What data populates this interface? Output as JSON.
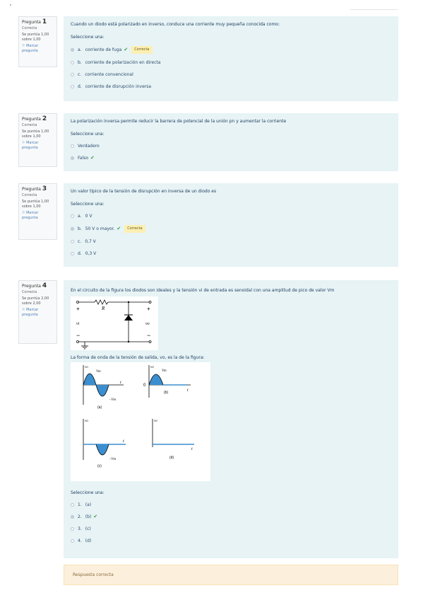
{
  "questions": [
    {
      "number_label": "Pregunta",
      "number": "1",
      "status": "Correcta",
      "points": "Se puntúa 1,00 sobre 1,00",
      "flag_label": "Marcar pregunta",
      "text": "Cuando un diodo está polarizado en inverso, conduce una corriente muy pequeña conocida como:",
      "prompt": "Seleccione una:",
      "options": [
        {
          "letter": "a.",
          "label": "corriente de fuga",
          "selected": true,
          "correct": true,
          "badge": "Correcta"
        },
        {
          "letter": "b.",
          "label": "corriente de polarización en directa",
          "selected": false
        },
        {
          "letter": "c.",
          "label": "corriente convencional",
          "selected": false
        },
        {
          "letter": "d.",
          "label": "corriente de disrupción inversa",
          "selected": false
        }
      ]
    },
    {
      "number_label": "Pregunta",
      "number": "2",
      "status": "Correcta",
      "points": "Se puntúa 1,00 sobre 1,00",
      "flag_label": "Marcar pregunta",
      "text": "La polarización inversa permite reducir la barrera de potencial de la unión pn y aumentar la corriente",
      "prompt": "Seleccione una:",
      "options": [
        {
          "letter": "",
          "label": "Verdadero",
          "selected": false
        },
        {
          "letter": "",
          "label": "Falso",
          "selected": true,
          "correct": true
        }
      ]
    },
    {
      "number_label": "Pregunta",
      "number": "3",
      "status": "Correcta",
      "points": "Se puntúa 1,00 sobre 1,00",
      "flag_label": "Marcar pregunta",
      "text": "Un valor típico de la tensión de disrupción en inversa de un diodo es",
      "prompt": "Seleccione una:",
      "options": [
        {
          "letter": "a.",
          "label": "0 V",
          "selected": false
        },
        {
          "letter": "b.",
          "label": "50 V o mayor.",
          "selected": true,
          "correct": true,
          "badge": "Correcta"
        },
        {
          "letter": "c.",
          "label": "0,7 V",
          "selected": false
        },
        {
          "letter": "d.",
          "label": "0,3 V",
          "selected": false
        }
      ]
    },
    {
      "number_label": "Pregunta",
      "number": "4",
      "status": "Correcta",
      "points": "Se puntúa 2,00 sobre 2,00",
      "flag_label": "Marcar pregunta",
      "text": "En el circuito de la figura los diodos son ideales y la tensión vi de entrada es senoidal con una amplitud de pico de valor Vm",
      "text2": "La forma de onda de la tensión de salida, vo, es la de la figura:",
      "prompt": "Seleccione una:",
      "options": [
        {
          "letter": "1.",
          "label": "(a)",
          "selected": false
        },
        {
          "letter": "2.",
          "label": "(b)",
          "selected": true,
          "correct": true
        },
        {
          "letter": "3.",
          "label": "(c)",
          "selected": false
        },
        {
          "letter": "4.",
          "label": "(d)",
          "selected": false
        }
      ],
      "circuit": {
        "R": "R",
        "vi": "vi",
        "vo": "vo",
        "plus": "+",
        "minus": "−"
      },
      "waves": {
        "vo": "vo",
        "t": "t",
        "vm": "Vm",
        "neg_vm": "−Vm",
        "zero": "0",
        "a": "(a)",
        "b": "(b)",
        "c": "(c)",
        "d": "(d)"
      }
    }
  ],
  "feedback": "Respuesta correcta",
  "colors": {
    "accent_blue": "#4a90c8",
    "wave_fill": "#3b8fd0",
    "correct_green": "#3a9d43"
  }
}
